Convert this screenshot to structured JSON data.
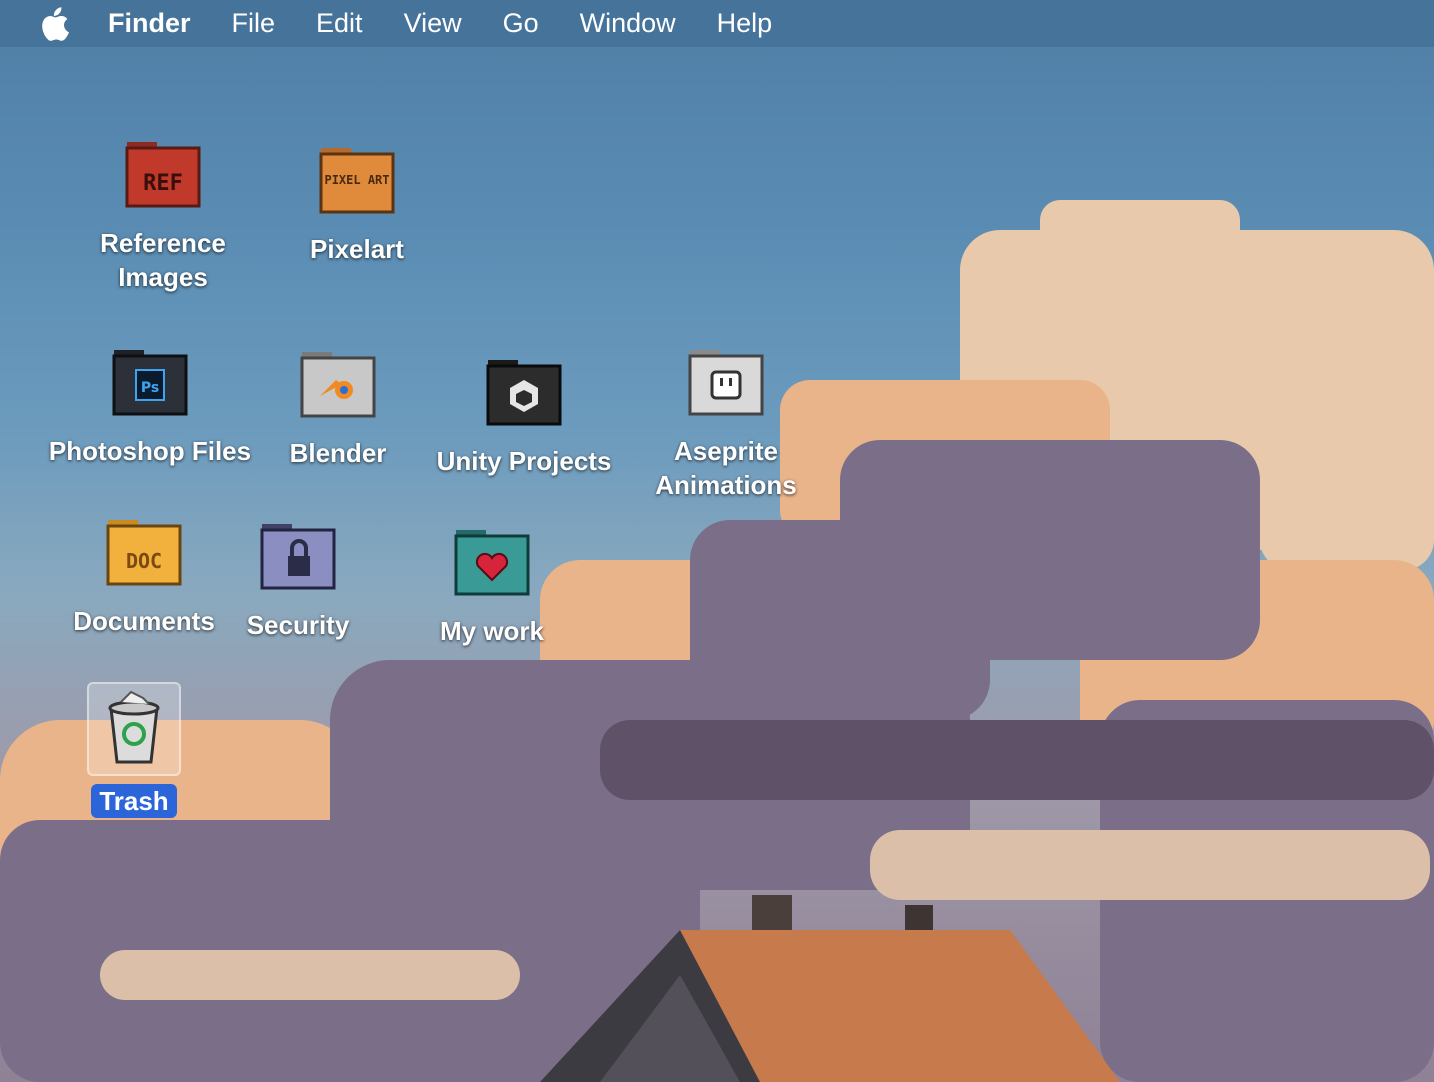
{
  "menubar": {
    "apple_icon": "apple-logo-icon",
    "items": [
      "Finder",
      "File",
      "Edit",
      "View",
      "Go",
      "Window",
      "Help"
    ]
  },
  "desktop": {
    "icons": [
      {
        "label": "Reference Images",
        "icon": "folder-ref-icon",
        "badge": "REF",
        "color": "#c0392b"
      },
      {
        "label": "Pixelart",
        "icon": "folder-pixel-art-icon",
        "badge": "PIXEL ART",
        "color": "#e08a3c"
      },
      {
        "label": "Photoshop Files",
        "icon": "folder-photoshop-icon",
        "badge": "Ps",
        "color": "#2c3038"
      },
      {
        "label": "Blender",
        "icon": "folder-blender-icon",
        "color": "#9a9a9a"
      },
      {
        "label": "Unity Projects",
        "icon": "folder-unity-icon",
        "color": "#2c2c2c"
      },
      {
        "label": "Aseprite Animations",
        "icon": "folder-aseprite-icon",
        "color": "#b5b5b5"
      },
      {
        "label": "Documents",
        "icon": "folder-doc-icon",
        "badge": "DOC",
        "color": "#f2b13c"
      },
      {
        "label": "Security",
        "icon": "folder-security-icon",
        "color": "#5b5f8a"
      },
      {
        "label": "My work",
        "icon": "folder-heart-icon",
        "color": "#3a9a96"
      },
      {
        "label": "Trash",
        "icon": "trash-icon",
        "selected": true
      }
    ]
  }
}
